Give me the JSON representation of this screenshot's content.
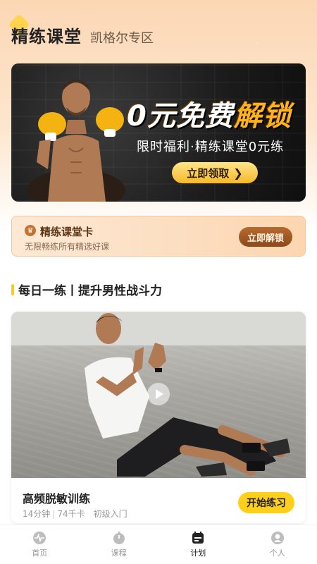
{
  "header": {
    "title": "精练课堂",
    "subtitle": "凯格尔专区"
  },
  "banner": {
    "headline_prefix": "0元免费",
    "headline_highlight": "解锁",
    "subline": "限时福利·精练课堂0元练",
    "button_label": "立即领取"
  },
  "membership_card": {
    "title": "精练课堂卡",
    "description": "无限畅练所有精选好课",
    "button_label": "立即解锁"
  },
  "section": {
    "title": "每日一练丨提升男性战斗力"
  },
  "course": {
    "title": "高频脱敏训练",
    "duration": "14分钟",
    "calories": "74千卡",
    "level": "初级入门",
    "start_label": "开始练习"
  },
  "tabbar": {
    "items": [
      {
        "label": "首页",
        "icon": "pulse-icon",
        "active": false
      },
      {
        "label": "课程",
        "icon": "stopwatch-icon",
        "active": false
      },
      {
        "label": "计划",
        "icon": "calendar-icon",
        "active": true
      },
      {
        "label": "个人",
        "icon": "user-icon",
        "active": false
      }
    ]
  },
  "colors": {
    "accent_yellow": "#ffcf1e",
    "card_brown": "#8a4a1a",
    "banner_gold": "#ffb21a"
  }
}
